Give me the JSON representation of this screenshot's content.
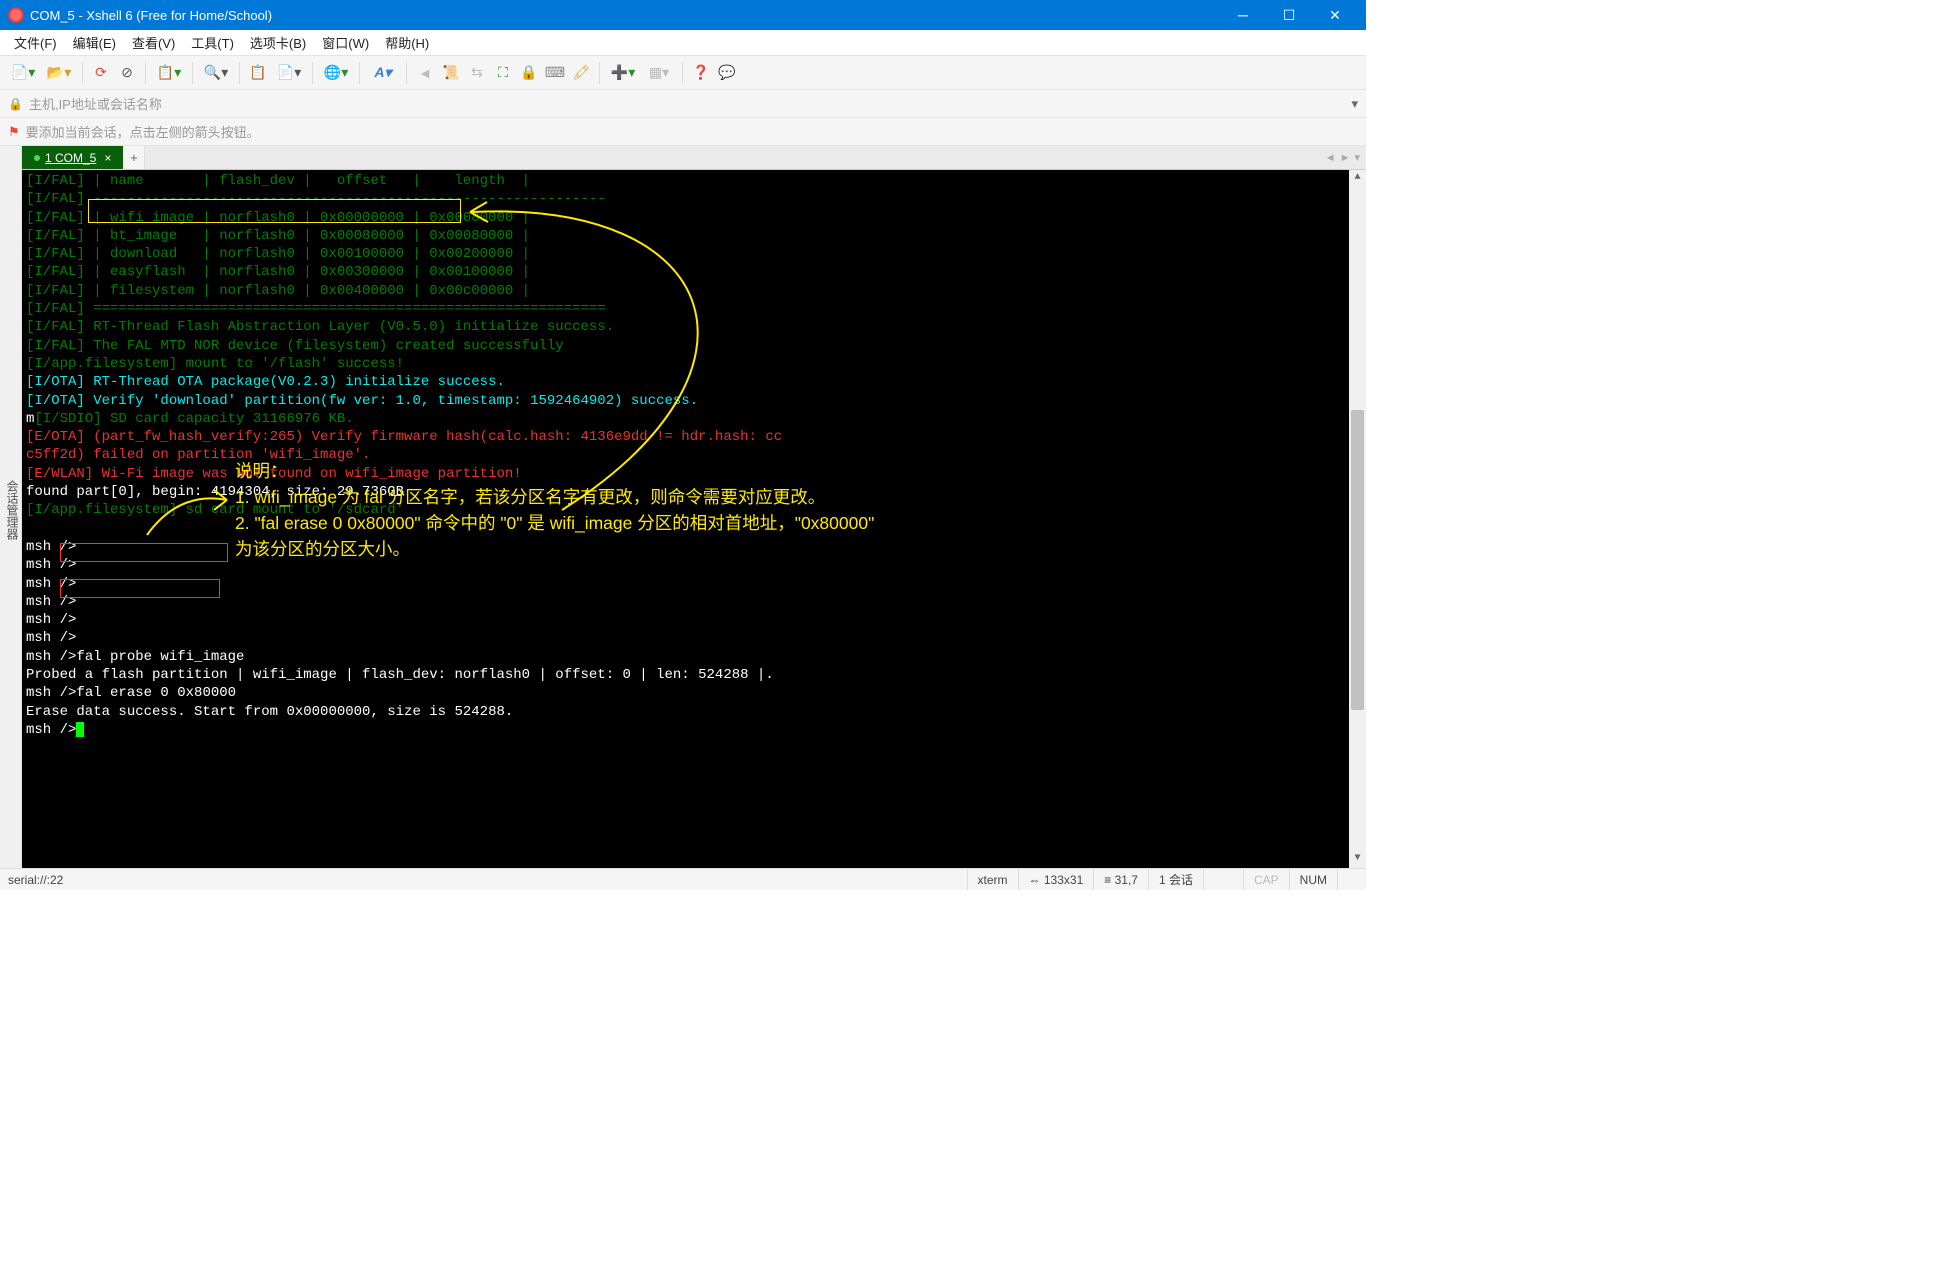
{
  "window": {
    "title": "COM_5 - Xshell 6 (Free for Home/School)"
  },
  "menu": {
    "file": "文件(F)",
    "edit": "编辑(E)",
    "view": "查看(V)",
    "tools": "工具(T)",
    "tabs": "选项卡(B)",
    "window": "窗口(W)",
    "help": "帮助(H)"
  },
  "address": {
    "placeholder": "主机,IP地址或会话名称"
  },
  "hint": {
    "text": "要添加当前会话，点击左侧的箭头按钮。"
  },
  "sidebar": {
    "label": "会话管理器"
  },
  "tab": {
    "label": "1 COM_5"
  },
  "term": {
    "l1": "[I/FAL] | name       | flash_dev |   offset   |    length  |",
    "l2": "[I/FAL] -------------------------------------------------------------",
    "l3": "[I/FAL] | wifi_image | norflash0 | 0x00000000 | 0x00080000 |",
    "l4": "[I/FAL] | bt_image   | norflash0 | 0x00080000 | 0x00080000 |",
    "l5": "[I/FAL] | download   | norflash0 | 0x00100000 | 0x00200000 |",
    "l6": "[I/FAL] | easyflash  | norflash0 | 0x00300000 | 0x00100000 |",
    "l7": "[I/FAL] | filesystem | norflash0 | 0x00400000 | 0x00c00000 |",
    "l8": "[I/FAL] =============================================================",
    "l9": "[I/FAL] RT-Thread Flash Abstraction Layer (V0.5.0) initialize success.",
    "l10": "[I/FAL] The FAL MTD NOR device (filesystem) created successfully",
    "l11": "[I/app.filesystem] mount to '/flash' success!",
    "l12": "[I/OTA] RT-Thread OTA package(V0.2.3) initialize success.",
    "l13": "[I/OTA] Verify 'download' partition(fw ver: 1.0, timestamp: 1592464902) success.",
    "l14a": "m",
    "l14b": "[I/SDIO] SD card capacity 31166976 KB.",
    "l15": "[E/OTA] (part_fw_hash_verify:265) Verify firmware hash(calc.hash: 4136e9dd != hdr.hash: cc",
    "l16": "c5ff2d) failed on partition 'wifi_image'.",
    "l17": "[E/WLAN] Wi-Fi image was NOT found on wifi_image partition!",
    "l18": "found part[0], begin: 4194304, size: 29.736GB",
    "l19": "[I/app.filesystem] sd card mount to '/sdcard'",
    "l20": "",
    "l21": "msh />",
    "l22": "msh />",
    "l23": "msh />",
    "l24": "msh />",
    "l25": "msh />",
    "l26": "msh />",
    "l27a": "msh />",
    "l27b": "fal probe wifi_image",
    "l28": "Probed a flash partition | wifi_image | flash_dev: norflash0 | offset: 0 | len: 524288 |.",
    "l29a": "msh />",
    "l29b": "fal erase 0 0x80000",
    "l30": "Erase data success. Start from 0x00000000, size is 524288.",
    "l31": "msh />"
  },
  "annotation": {
    "title": "说明：",
    "line1": "1. wifi_image 为 fal 分区名字，若该分区名字有更改，则命令需要对应更改。",
    "line2": "2. \"fal erase 0 0x80000\" 命令中的 \"0\" 是 wifi_image 分区的相对首地址，\"0x80000\"",
    "line3": "为该分区的分区大小。"
  },
  "status": {
    "conn": "serial://:22",
    "term": "xterm",
    "size_icon": "⇔",
    "size": "133x31",
    "pos_icon": "≡",
    "pos": "31,7",
    "sessions": "1 会话",
    "cap": "CAP",
    "num": "NUM"
  }
}
